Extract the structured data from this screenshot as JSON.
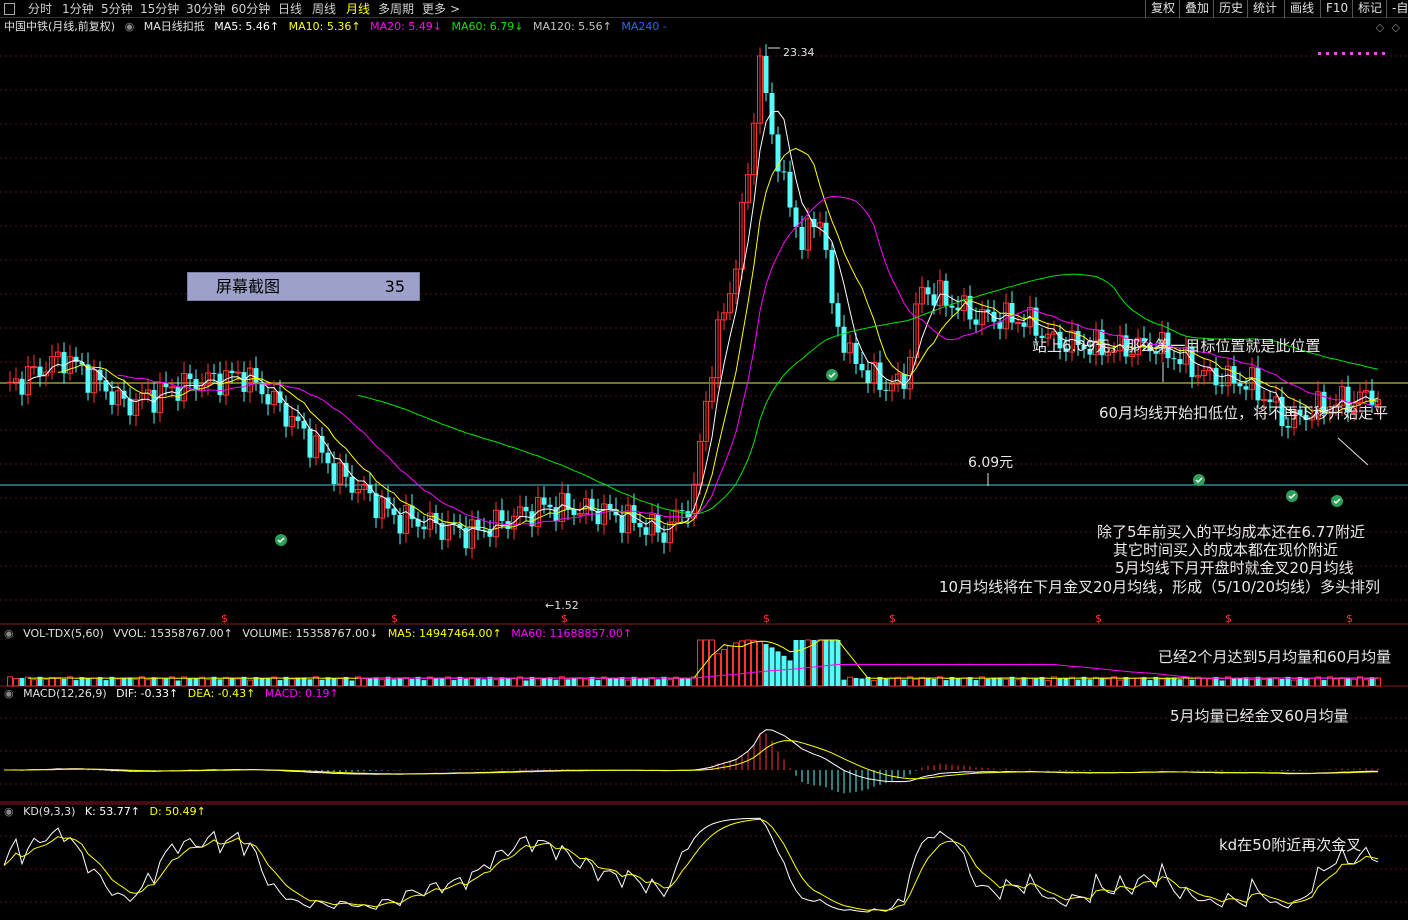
{
  "toolbar": {
    "periods": [
      "分时",
      "1分钟",
      "5分钟",
      "15分钟",
      "30分钟",
      "60分钟",
      "日线",
      "周线",
      "月线",
      "多周期",
      "更多"
    ],
    "active_period": "月线",
    "more_arrow": ">",
    "right_buttons": [
      "复权",
      "叠加",
      "历史",
      "统计",
      "画线",
      "F10",
      "标记",
      "-自"
    ]
  },
  "main_panel": {
    "stock": "中国中铁(月线,前复权)",
    "indicator": "MA日线扣抵",
    "ma5": "MA5: 5.46↑",
    "ma10": "MA10: 5.36↑",
    "ma20": "MA20: 5.49↓",
    "ma60": "MA60: 6.79↓",
    "ma120": "MA120: 5.56↑",
    "ma240": "MA240 -",
    "high_label": "23.34",
    "low_label": "1.52",
    "price_609": "6.09元",
    "nav_icons": [
      "◇",
      "◇"
    ]
  },
  "vol_panel": {
    "name": "VOL-TDX(5,60)",
    "vvol": "VVOL: 15358767.00↑",
    "volume": "VOLUME: 15358767.00↓",
    "ma5": "MA5: 14947464.00↑",
    "ma60": "MA60: 11688857.00↑"
  },
  "macd_panel": {
    "name": "MACD(12,26,9)",
    "dif": "DIF: -0.33↑",
    "dea": "DEA: -0.43↑",
    "macd": "MACD: 0.19↑"
  },
  "kd_panel": {
    "name": "KD(9,3,3)",
    "k": "K: 53.77↑",
    "d": "D: 50.49↑"
  },
  "screenshot_badge": {
    "label": "屏幕截图",
    "number": "35"
  },
  "annotations": {
    "stand_above": "站上6.09元，那么第一目标位置就是此位置",
    "ma60_deduct": "60月均线开始扣低位，将不再下移开始走平",
    "cost_1": "除了5年前买入的平均成本还在6.77附近",
    "cost_2": "其它时间买入的成本都在现价附近",
    "cost_3": "5月均线下月开盘时就金叉20月均线",
    "cost_4": "10月均线将在下月金叉20月均线，形成（5/10/20均线）多头排列",
    "vol_note": "已经2个月达到5月均量和60月均量",
    "macd_note": "5月均量已经金叉60月均量",
    "kd_note": "kd在50附近再次金叉"
  },
  "dividend_marker": "$",
  "colors": {
    "up": "#ff3232",
    "down": "#54fcfc",
    "ma5": "#ffffff",
    "ma10": "#ffff00",
    "ma20": "#ff00ff",
    "ma60": "#00e600",
    "ma120": "#c0c0c0",
    "ma240": "#3264ff",
    "yellow_line": "#e6e650",
    "cyan_line": "#50c8dc"
  }
}
